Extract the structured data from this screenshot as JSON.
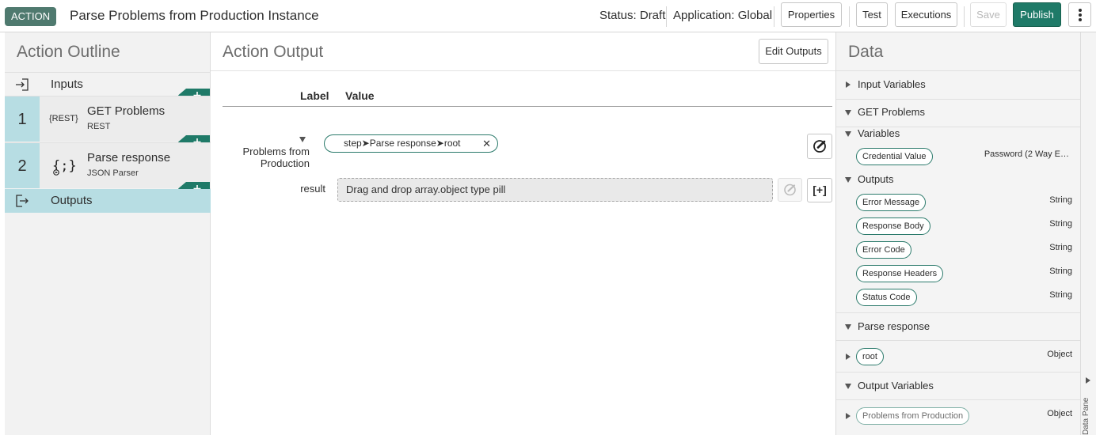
{
  "header": {
    "badge": "ACTION",
    "title": "Parse Problems from Production Instance",
    "status": "Status: Draft",
    "application": "Application: Global",
    "buttons": {
      "properties": "Properties",
      "test": "Test",
      "executions": "Executions",
      "save": "Save",
      "publish": "Publish"
    }
  },
  "outline": {
    "title": "Action Outline",
    "inputs_label": "Inputs",
    "steps": [
      {
        "number": "1",
        "name": "GET Problems",
        "type": "REST",
        "icon_text": "{REST}",
        "icon": "rest-icon"
      },
      {
        "number": "2",
        "name": "Parse response",
        "type": "JSON Parser",
        "icon": "json-parser-icon"
      }
    ],
    "outputs_label": "Outputs"
  },
  "output": {
    "title": "Action Output",
    "edit_button": "Edit Outputs",
    "col_label": "Label",
    "col_value": "Value",
    "rows": [
      {
        "label": "Problems from Production",
        "pill": "step➤Parse response➤root"
      },
      {
        "label": "result",
        "placeholder": "Drag and drop array.object type pill"
      }
    ],
    "add_bracket": "[+]"
  },
  "data_panel": {
    "title": "Data",
    "input_variables": "Input Variables",
    "get_problems": {
      "title": "GET Problems",
      "variables_title": "Variables",
      "variables": [
        {
          "name": "Credential Value",
          "type": "Password (2 Way E…"
        }
      ],
      "outputs_title": "Outputs",
      "outputs": [
        {
          "name": "Error Message",
          "type": "String"
        },
        {
          "name": "Response Body",
          "type": "String"
        },
        {
          "name": "Error Code",
          "type": "String"
        },
        {
          "name": "Response Headers",
          "type": "String"
        },
        {
          "name": "Status Code",
          "type": "String"
        }
      ]
    },
    "parse_response": {
      "title": "Parse response",
      "items": [
        {
          "name": "root",
          "type": "Object"
        }
      ]
    },
    "output_variables": {
      "title": "Output Variables",
      "items": [
        {
          "name": "Problems from Production",
          "type": "Object"
        }
      ]
    },
    "collapse_label": "Data Panel"
  },
  "colors": {
    "accent_green": "#1f7a68",
    "badge_green": "#4f7a6f",
    "step_blue": "#b7dde3",
    "pill_border": "#2b7a6b"
  }
}
